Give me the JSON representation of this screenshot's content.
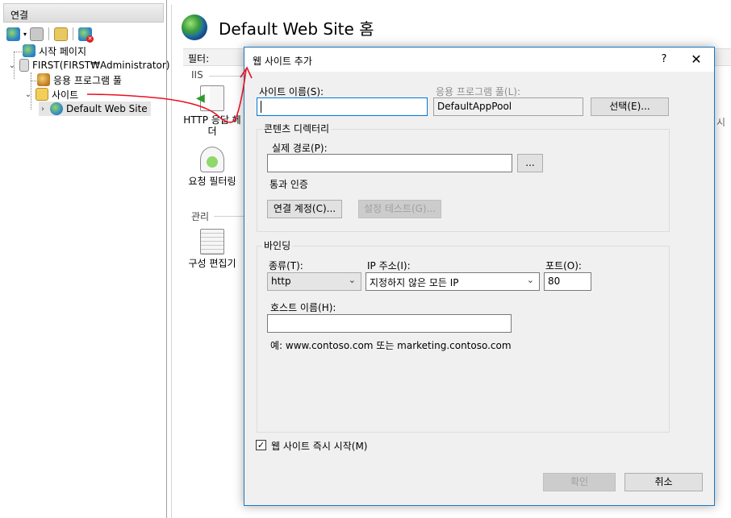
{
  "connections": {
    "header": "연결",
    "toolbar_icons": [
      "connect-globe-icon",
      "save-icon",
      "folder-up-icon",
      "disconnect-icon"
    ],
    "tree": {
      "start_page": "시작 페이지",
      "server": "FIRST(FIRST₩Administrator)",
      "app_pools": "응용 프로그램 풀",
      "sites": "사이트",
      "default_site": "Default Web Site"
    }
  },
  "main": {
    "title": "Default Web Site 홈",
    "filter_label": "필터:",
    "group_iis": "IIS",
    "feature_http": "HTTP 응답 헤더",
    "feature_request_filter": "요청 필터링",
    "group_manage": "관리",
    "feature_config_editor": "구성 편집기",
    "right_edge_text": "시"
  },
  "dialog": {
    "title": "웹 사이트 추가",
    "help": "?",
    "close": "✕",
    "site_name_label": "사이트 이름(S):",
    "site_name_value": "",
    "app_pool_label": "응용 프로그램 풀(L):",
    "app_pool_value": "DefaultAppPool",
    "select_button": "선택(E)...",
    "content_dir_legend": "콘텐츠 디렉터리",
    "physical_path_label": "실제 경로(P):",
    "physical_path_value": "",
    "browse_button": "...",
    "pass_auth_label": "통과 인증",
    "connect_as_button": "연결 계정(C)...",
    "test_settings_button": "설정 테스트(G)...",
    "binding_legend": "바인딩",
    "type_label": "종류(T):",
    "type_value": "http",
    "ip_label": "IP 주소(I):",
    "ip_value": "지정하지 않은 모든 IP",
    "port_label": "포트(O):",
    "port_value": "80",
    "host_label": "호스트 이름(H):",
    "host_value": "",
    "example_text": "예: www.contoso.com 또는 marketing.contoso.com",
    "start_immediately_label": "웹 사이트 즉시 시작(M)",
    "start_immediately_checked": true,
    "ok_button": "확인",
    "cancel_button": "취소"
  },
  "colors": {
    "dialog_border": "#1f78c1",
    "annotation_red": "#e81123"
  }
}
